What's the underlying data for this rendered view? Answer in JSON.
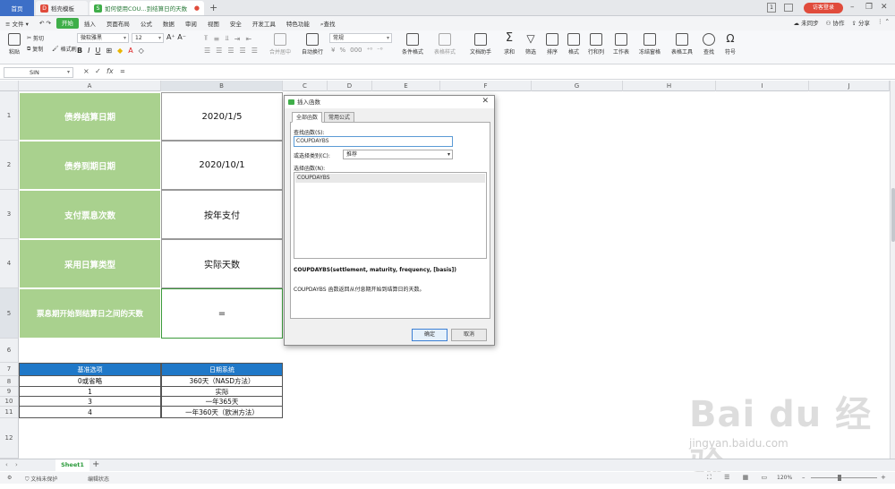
{
  "titlebar": {
    "home_tab": "首页",
    "tab2": "稻壳模板",
    "tab3": "如何使用COU...到结算日的天数",
    "new_tab": "+",
    "badge": "1",
    "login": "访客登录"
  },
  "menubar": {
    "file": "文件",
    "items": [
      "开始",
      "插入",
      "页面布局",
      "公式",
      "数据",
      "审阅",
      "视图",
      "安全",
      "开发工具",
      "特色功能"
    ],
    "search": "查找",
    "sync": "未同步",
    "collab": "协作",
    "share": "分享"
  },
  "ribbon": {
    "paste": "粘贴",
    "cut": "剪切",
    "copy": "复制",
    "format_painter": "格式刷",
    "font_name": "微软雅黑",
    "font_size": "12",
    "merge_center": "合并居中",
    "wrap_text": "自动换行",
    "number_format": "常规",
    "conditional_format": "条件格式",
    "table_style": "表格样式",
    "doc_helper": "文档助手",
    "sum": "求和",
    "filter": "筛选",
    "sort": "排序",
    "format": "格式",
    "rows_cols": "行和列",
    "worksheet": "工作表",
    "freeze": "冻结窗格",
    "table_tools": "表格工具",
    "find": "查找",
    "symbol": "符号"
  },
  "formulabar": {
    "name_box": "SIN",
    "cancel": "×",
    "confirm": "✓",
    "fx": "fx",
    "value": "="
  },
  "columns": [
    "A",
    "B",
    "C",
    "D",
    "E",
    "F",
    "G",
    "H",
    "I",
    "J"
  ],
  "rows": [
    "1",
    "2",
    "3",
    "4",
    "5",
    "6",
    "7",
    "8",
    "9",
    "10",
    "11",
    "12"
  ],
  "main_table": [
    {
      "label": "债券结算日期",
      "value": "2020/1/5"
    },
    {
      "label": "债券到期日期",
      "value": "2020/10/1"
    },
    {
      "label": "支付票息次数",
      "value": "按年支付"
    },
    {
      "label": "采用日算类型",
      "value": "实际天数"
    },
    {
      "label": "票息期开始到结算日之间的天数",
      "value": "="
    }
  ],
  "basis_table": {
    "headers": [
      "基准选项",
      "日期系统"
    ],
    "rows": [
      [
        "0或省略",
        "360天（NASD方法）"
      ],
      [
        "1",
        "实际"
      ],
      [
        "3",
        "一年365天"
      ],
      [
        "4",
        "一年360天（欧洲方法）"
      ]
    ]
  },
  "dialog": {
    "title": "插入函数",
    "tab_all": "全部函数",
    "tab_common": "常用公式",
    "search_label": "查找函数(S):",
    "search_value": "COUPDAYBS",
    "category_label": "或选择类别(C):",
    "category_value": "推荐",
    "select_label": "选择函数(N):",
    "list_item": "COUPDAYBS",
    "syntax": "COUPDAYBS(settlement, maturity, frequency, [basis])",
    "description": "COUPDAYBS 函数返回从付息期开始到结算日的天数。",
    "ok": "确定",
    "cancel": "取消"
  },
  "sheetbar": {
    "sheet": "Sheet1",
    "add": "+"
  },
  "statusbar": {
    "protect": "文档未保护",
    "mode": "编辑状态",
    "zoom": "120%"
  },
  "watermark": {
    "text": "Bai du 经验",
    "url": "jingyan.baidu.com"
  }
}
